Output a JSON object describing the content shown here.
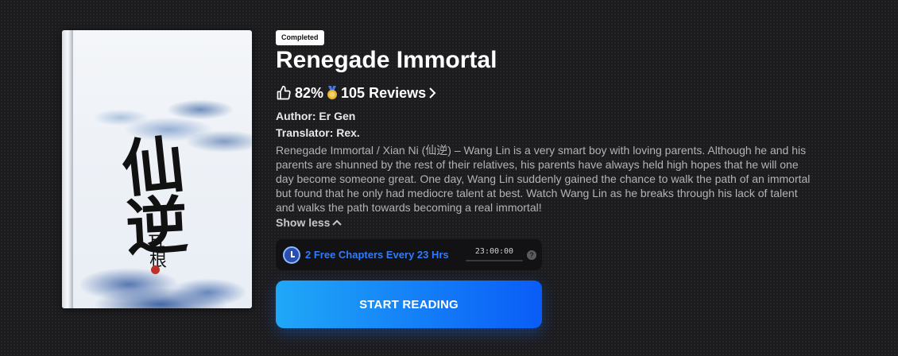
{
  "book": {
    "status_badge": "Completed",
    "title": "Renegade Immortal",
    "rating_percent": "82%",
    "reviews_label": "105 Reviews",
    "author_label": "Author: Er Gen",
    "translator_label": "Translator: Rex.",
    "description": "Renegade Immortal / Xian Ni (仙逆) – Wang Lin is a very smart boy with loving parents. Although he and his parents are shunned by the rest of their relatives, his parents have always held high hopes that he will one day become someone great. One day, Wang Lin suddenly gained the chance to walk the path of an immortal but found that he only had mediocre talent at best. Watch Wang Lin as he breaks through his lack of talent and walks the path towards becoming a real immortal!",
    "show_less_label": "Show less"
  },
  "cover": {
    "glyph_1": "仙",
    "glyph_2": "逆",
    "glyph_3": "耳",
    "glyph_4": "根"
  },
  "free_chapters": {
    "label": "2 Free Chapters Every 23 Hrs",
    "countdown": "23:00:00",
    "help_glyph": "?"
  },
  "cta": {
    "start_label": "START READING"
  },
  "icons": {
    "rating": "thumbs-up-icon",
    "award": "medal-icon",
    "reviews": "chevron-right-icon",
    "show_less": "chevron-up-icon",
    "timer": "clock-icon",
    "help": "help-icon"
  },
  "colors": {
    "accent": "#2f7bff",
    "button_gradient_start": "#20a8f7",
    "button_gradient_end": "#0a5cf7",
    "medal": "#e6b535"
  }
}
